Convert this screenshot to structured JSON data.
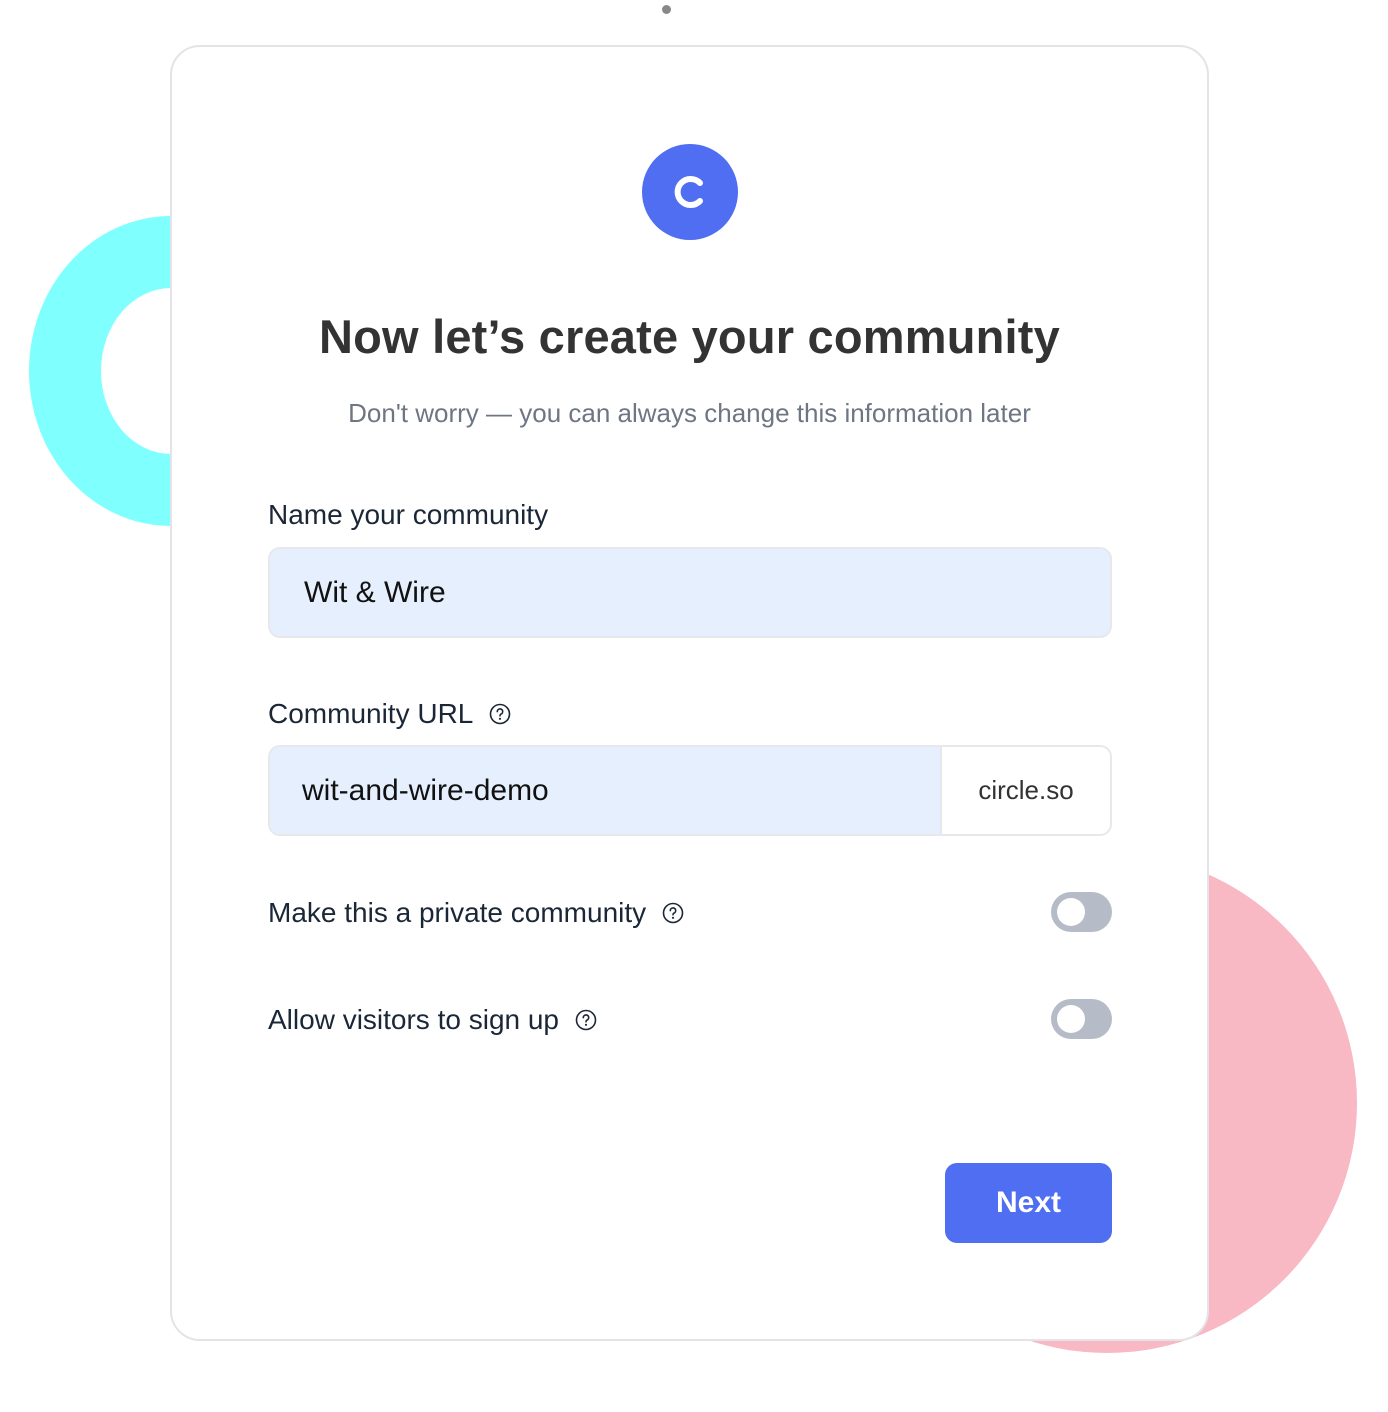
{
  "colors": {
    "accent": "#506ef2",
    "ring_decoration": "#80ffff",
    "circle_decoration": "#f8b8c4",
    "input_fill": "#e6effd",
    "toggle_off": "#b6bcc7"
  },
  "logo": {
    "letter": "C",
    "icon": "circle-logo-icon"
  },
  "header": {
    "title": "Now let’s create your community",
    "subtitle": "Don't worry — you can always change this information later"
  },
  "form": {
    "name_field": {
      "label": "Name your community",
      "value": "Wit & Wire"
    },
    "url_field": {
      "label": "Community URL",
      "help_icon": "question-circle-icon",
      "value": "wit-and-wire-demo",
      "suffix": "circle.so"
    },
    "toggles": [
      {
        "label": "Make this a private community",
        "help_icon": "question-circle-icon",
        "on": false
      },
      {
        "label": "Allow visitors to sign up",
        "help_icon": "question-circle-icon",
        "on": false
      }
    ]
  },
  "actions": {
    "next_label": "Next"
  }
}
